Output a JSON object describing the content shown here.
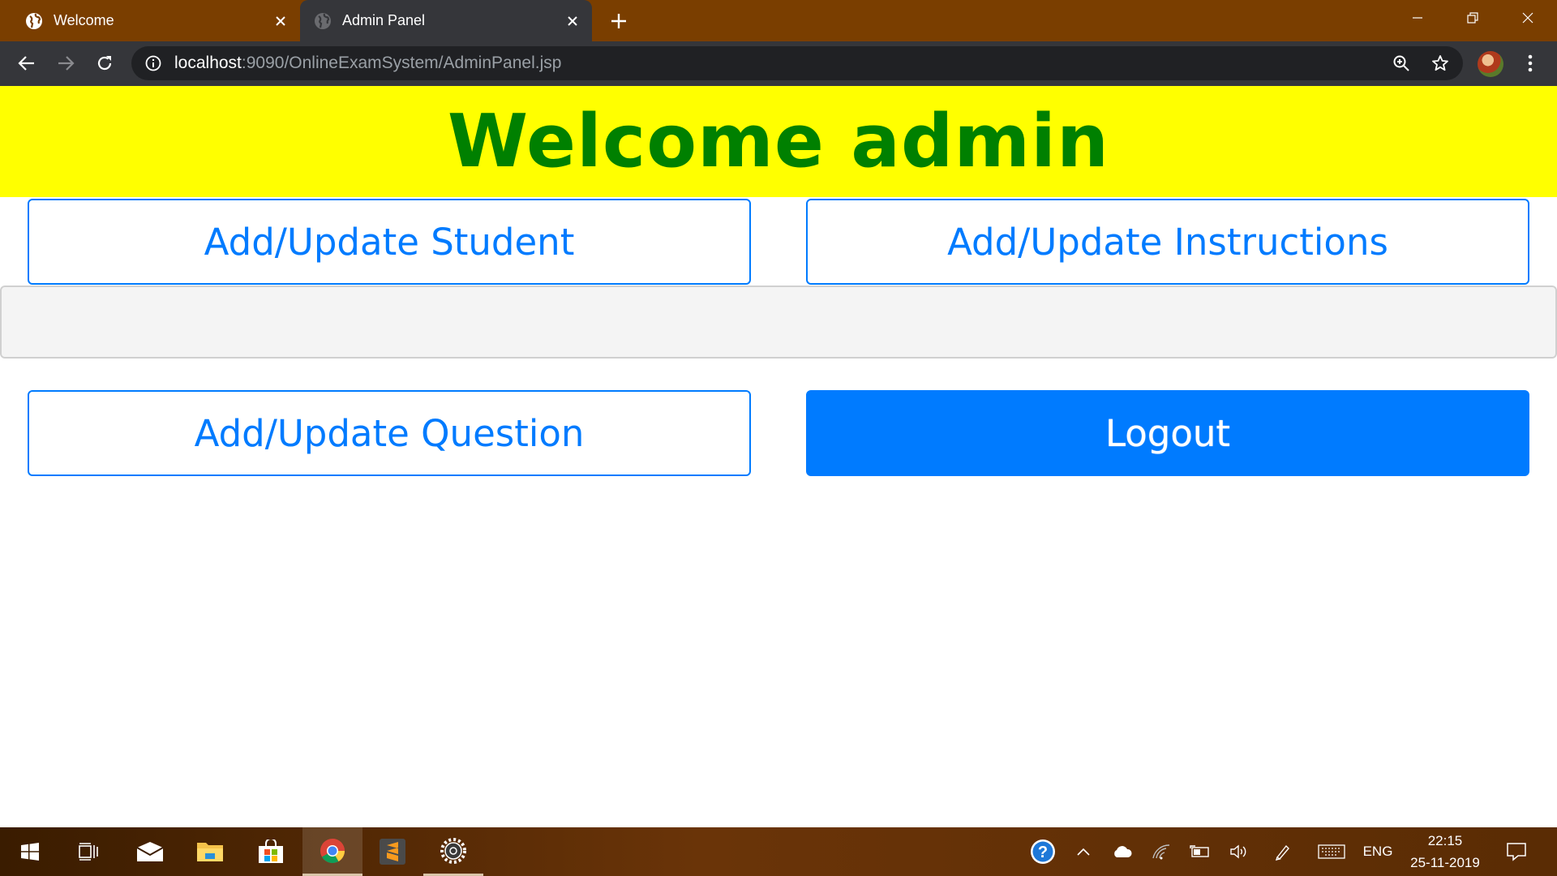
{
  "browser": {
    "tabs": [
      {
        "title": "Welcome",
        "active": false
      },
      {
        "title": "Admin Panel",
        "active": true
      }
    ],
    "address": {
      "host": "localhost",
      "path": ":9090/OnlineExamSystem/AdminPanel.jsp"
    },
    "icons": {
      "tab_favicon": "globe-icon",
      "close": "close-icon",
      "new_tab": "plus-icon",
      "back": "back-arrow-icon",
      "forward": "forward-arrow-icon",
      "reload": "reload-icon",
      "site_info": "info-icon",
      "zoom": "zoom-icon",
      "bookmark": "star-icon",
      "profile": "avatar",
      "menu": "kebab-menu-icon"
    }
  },
  "page": {
    "heading": "Welcome admin",
    "buttons": {
      "student": "Add/Update Student",
      "instructions": "Add/Update Instructions",
      "question": "Add/Update Question",
      "logout": "Logout"
    }
  },
  "taskbar": {
    "apps": [
      "windows-start-icon",
      "task-view-icon",
      "mail-icon",
      "file-explorer-icon",
      "store-icon",
      "chrome-icon",
      "sublime-text-icon",
      "settings-app-icon"
    ],
    "tray": [
      "help-icon",
      "chevron-up-icon",
      "onedrive-cloud-icon",
      "wifi-icon",
      "battery-icon",
      "volume-icon",
      "pen-icon",
      "keyboard-icon"
    ],
    "language": "ENG",
    "time": "22:15",
    "date": "25-11-2019"
  },
  "colors": {
    "banner_bg": "#ffff00",
    "heading": "#008000",
    "primary": "#007bff",
    "tabstrip": "#7a3e00",
    "toolbar": "#35363a"
  }
}
